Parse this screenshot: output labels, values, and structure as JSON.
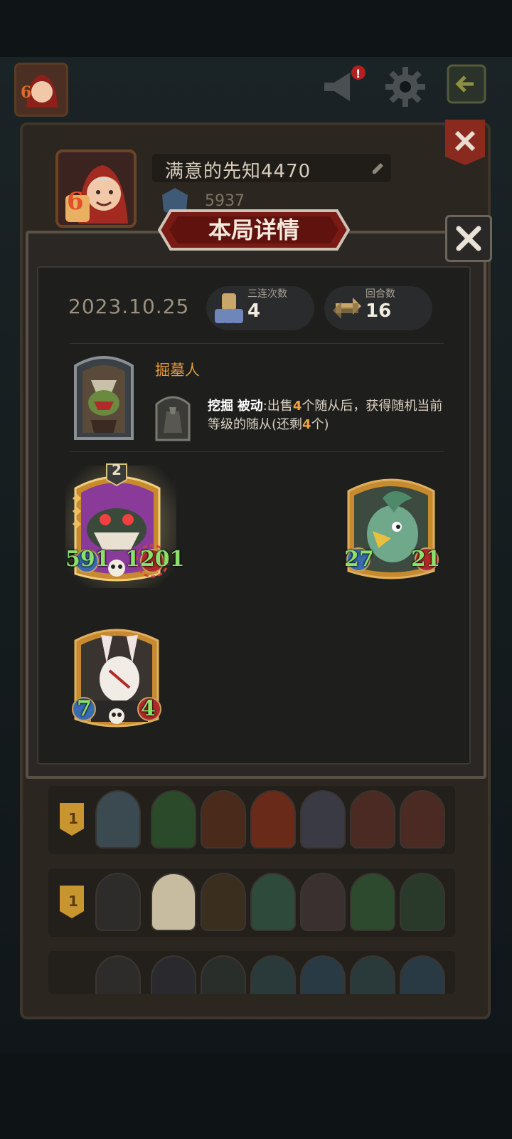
{
  "profile": {
    "name": "满意的先知4470",
    "rating": "5937",
    "level_badge": "6"
  },
  "detail": {
    "title": "本局详情",
    "date": "2023.10.25",
    "stats": [
      {
        "label": "三连次数",
        "value": "4"
      },
      {
        "label": "回合数",
        "value": "16"
      }
    ],
    "hero": {
      "name": "掘墓人",
      "skill_name": "挖掘",
      "skill_type": "被动",
      "skill_text_a": ":出售",
      "skill_num1": "4",
      "skill_text_b": "个随从后，获得随机当前等级的随从(还剩",
      "skill_num2": "4",
      "skill_text_c": "个)"
    },
    "minions": [
      {
        "name": "purple-monster",
        "tier": "2",
        "attack": "591",
        "health": "1201"
      },
      {
        "name": "green-bird",
        "attack": "27",
        "health": "21"
      },
      {
        "name": "rabbit-mask",
        "attack": "7",
        "health": "4"
      }
    ]
  },
  "history": [
    {
      "rank": "1"
    },
    {
      "rank": "1"
    },
    {
      "rank": ""
    }
  ],
  "colors": {
    "accent": "#e39a3a",
    "banner": "#7a1a14",
    "stat_green": "#8be06a"
  }
}
